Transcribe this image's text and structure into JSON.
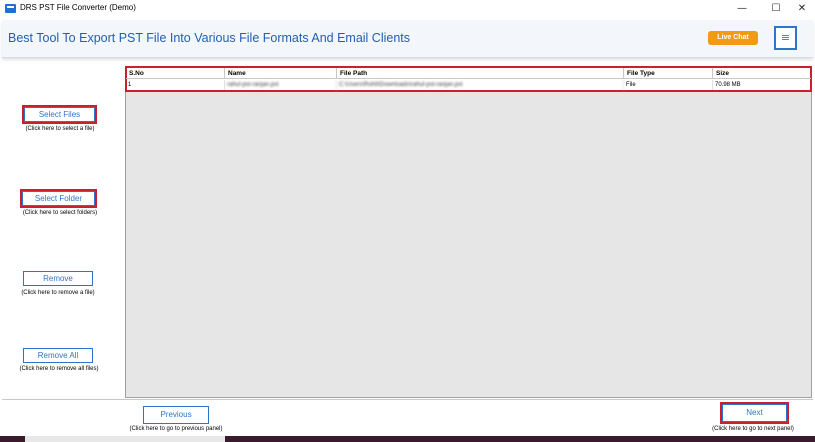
{
  "window": {
    "title": "DRS PST File Converter (Demo)",
    "controls": {
      "minimize": "—",
      "maximize": "☐",
      "close": "✕"
    }
  },
  "header": {
    "title": "Best Tool To Export PST File Into Various File Formats And Email Clients",
    "live_chat": "Live Chat",
    "menu_icon": "≡"
  },
  "sidebar": {
    "items": [
      {
        "label": "Select Files",
        "hint": "(Click here to select a file)"
      },
      {
        "label": "Select Folder",
        "hint": "(Click here to select folders)"
      },
      {
        "label": "Remove",
        "hint": "(Click here to remove a file)"
      },
      {
        "label": "Remove All",
        "hint": "(Click here to remove all files)"
      }
    ]
  },
  "table": {
    "columns": [
      "S.No",
      "Name",
      "File Path",
      "File Type",
      "Size"
    ],
    "rows": [
      {
        "sno": "1",
        "name": "rahul-pst-ranjan.pst",
        "path": "C:\\Users\\Rohit\\Downloads\\rahul-pst-ranjan.pst",
        "type": "File",
        "size": "70.98 MB"
      }
    ]
  },
  "footer": {
    "previous": {
      "label": "Previous",
      "hint": "(Click here to go to previous panel)"
    },
    "next": {
      "label": "Next",
      "hint": "(Click here to go to next panel)"
    }
  },
  "colors": {
    "accent": "#2e74c9",
    "highlight": "#c9202b",
    "live_chat": "#f29a12"
  }
}
